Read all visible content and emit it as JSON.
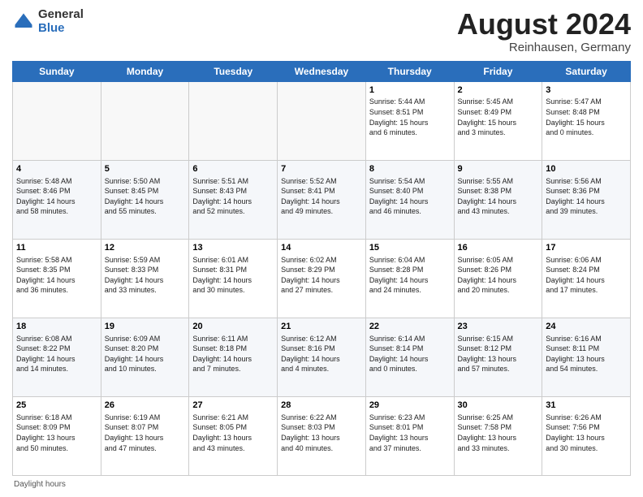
{
  "logo": {
    "general": "General",
    "blue": "Blue"
  },
  "title": {
    "month_year": "August 2024",
    "location": "Reinhausen, Germany"
  },
  "days_of_week": [
    "Sunday",
    "Monday",
    "Tuesday",
    "Wednesday",
    "Thursday",
    "Friday",
    "Saturday"
  ],
  "footer": {
    "daylight_label": "Daylight hours"
  },
  "weeks": [
    [
      {
        "day": "",
        "info": ""
      },
      {
        "day": "",
        "info": ""
      },
      {
        "day": "",
        "info": ""
      },
      {
        "day": "",
        "info": ""
      },
      {
        "day": "1",
        "info": "Sunrise: 5:44 AM\nSunset: 8:51 PM\nDaylight: 15 hours\nand 6 minutes."
      },
      {
        "day": "2",
        "info": "Sunrise: 5:45 AM\nSunset: 8:49 PM\nDaylight: 15 hours\nand 3 minutes."
      },
      {
        "day": "3",
        "info": "Sunrise: 5:47 AM\nSunset: 8:48 PM\nDaylight: 15 hours\nand 0 minutes."
      }
    ],
    [
      {
        "day": "4",
        "info": "Sunrise: 5:48 AM\nSunset: 8:46 PM\nDaylight: 14 hours\nand 58 minutes."
      },
      {
        "day": "5",
        "info": "Sunrise: 5:50 AM\nSunset: 8:45 PM\nDaylight: 14 hours\nand 55 minutes."
      },
      {
        "day": "6",
        "info": "Sunrise: 5:51 AM\nSunset: 8:43 PM\nDaylight: 14 hours\nand 52 minutes."
      },
      {
        "day": "7",
        "info": "Sunrise: 5:52 AM\nSunset: 8:41 PM\nDaylight: 14 hours\nand 49 minutes."
      },
      {
        "day": "8",
        "info": "Sunrise: 5:54 AM\nSunset: 8:40 PM\nDaylight: 14 hours\nand 46 minutes."
      },
      {
        "day": "9",
        "info": "Sunrise: 5:55 AM\nSunset: 8:38 PM\nDaylight: 14 hours\nand 43 minutes."
      },
      {
        "day": "10",
        "info": "Sunrise: 5:56 AM\nSunset: 8:36 PM\nDaylight: 14 hours\nand 39 minutes."
      }
    ],
    [
      {
        "day": "11",
        "info": "Sunrise: 5:58 AM\nSunset: 8:35 PM\nDaylight: 14 hours\nand 36 minutes."
      },
      {
        "day": "12",
        "info": "Sunrise: 5:59 AM\nSunset: 8:33 PM\nDaylight: 14 hours\nand 33 minutes."
      },
      {
        "day": "13",
        "info": "Sunrise: 6:01 AM\nSunset: 8:31 PM\nDaylight: 14 hours\nand 30 minutes."
      },
      {
        "day": "14",
        "info": "Sunrise: 6:02 AM\nSunset: 8:29 PM\nDaylight: 14 hours\nand 27 minutes."
      },
      {
        "day": "15",
        "info": "Sunrise: 6:04 AM\nSunset: 8:28 PM\nDaylight: 14 hours\nand 24 minutes."
      },
      {
        "day": "16",
        "info": "Sunrise: 6:05 AM\nSunset: 8:26 PM\nDaylight: 14 hours\nand 20 minutes."
      },
      {
        "day": "17",
        "info": "Sunrise: 6:06 AM\nSunset: 8:24 PM\nDaylight: 14 hours\nand 17 minutes."
      }
    ],
    [
      {
        "day": "18",
        "info": "Sunrise: 6:08 AM\nSunset: 8:22 PM\nDaylight: 14 hours\nand 14 minutes."
      },
      {
        "day": "19",
        "info": "Sunrise: 6:09 AM\nSunset: 8:20 PM\nDaylight: 14 hours\nand 10 minutes."
      },
      {
        "day": "20",
        "info": "Sunrise: 6:11 AM\nSunset: 8:18 PM\nDaylight: 14 hours\nand 7 minutes."
      },
      {
        "day": "21",
        "info": "Sunrise: 6:12 AM\nSunset: 8:16 PM\nDaylight: 14 hours\nand 4 minutes."
      },
      {
        "day": "22",
        "info": "Sunrise: 6:14 AM\nSunset: 8:14 PM\nDaylight: 14 hours\nand 0 minutes."
      },
      {
        "day": "23",
        "info": "Sunrise: 6:15 AM\nSunset: 8:12 PM\nDaylight: 13 hours\nand 57 minutes."
      },
      {
        "day": "24",
        "info": "Sunrise: 6:16 AM\nSunset: 8:11 PM\nDaylight: 13 hours\nand 54 minutes."
      }
    ],
    [
      {
        "day": "25",
        "info": "Sunrise: 6:18 AM\nSunset: 8:09 PM\nDaylight: 13 hours\nand 50 minutes."
      },
      {
        "day": "26",
        "info": "Sunrise: 6:19 AM\nSunset: 8:07 PM\nDaylight: 13 hours\nand 47 minutes."
      },
      {
        "day": "27",
        "info": "Sunrise: 6:21 AM\nSunset: 8:05 PM\nDaylight: 13 hours\nand 43 minutes."
      },
      {
        "day": "28",
        "info": "Sunrise: 6:22 AM\nSunset: 8:03 PM\nDaylight: 13 hours\nand 40 minutes."
      },
      {
        "day": "29",
        "info": "Sunrise: 6:23 AM\nSunset: 8:01 PM\nDaylight: 13 hours\nand 37 minutes."
      },
      {
        "day": "30",
        "info": "Sunrise: 6:25 AM\nSunset: 7:58 PM\nDaylight: 13 hours\nand 33 minutes."
      },
      {
        "day": "31",
        "info": "Sunrise: 6:26 AM\nSunset: 7:56 PM\nDaylight: 13 hours\nand 30 minutes."
      }
    ]
  ]
}
